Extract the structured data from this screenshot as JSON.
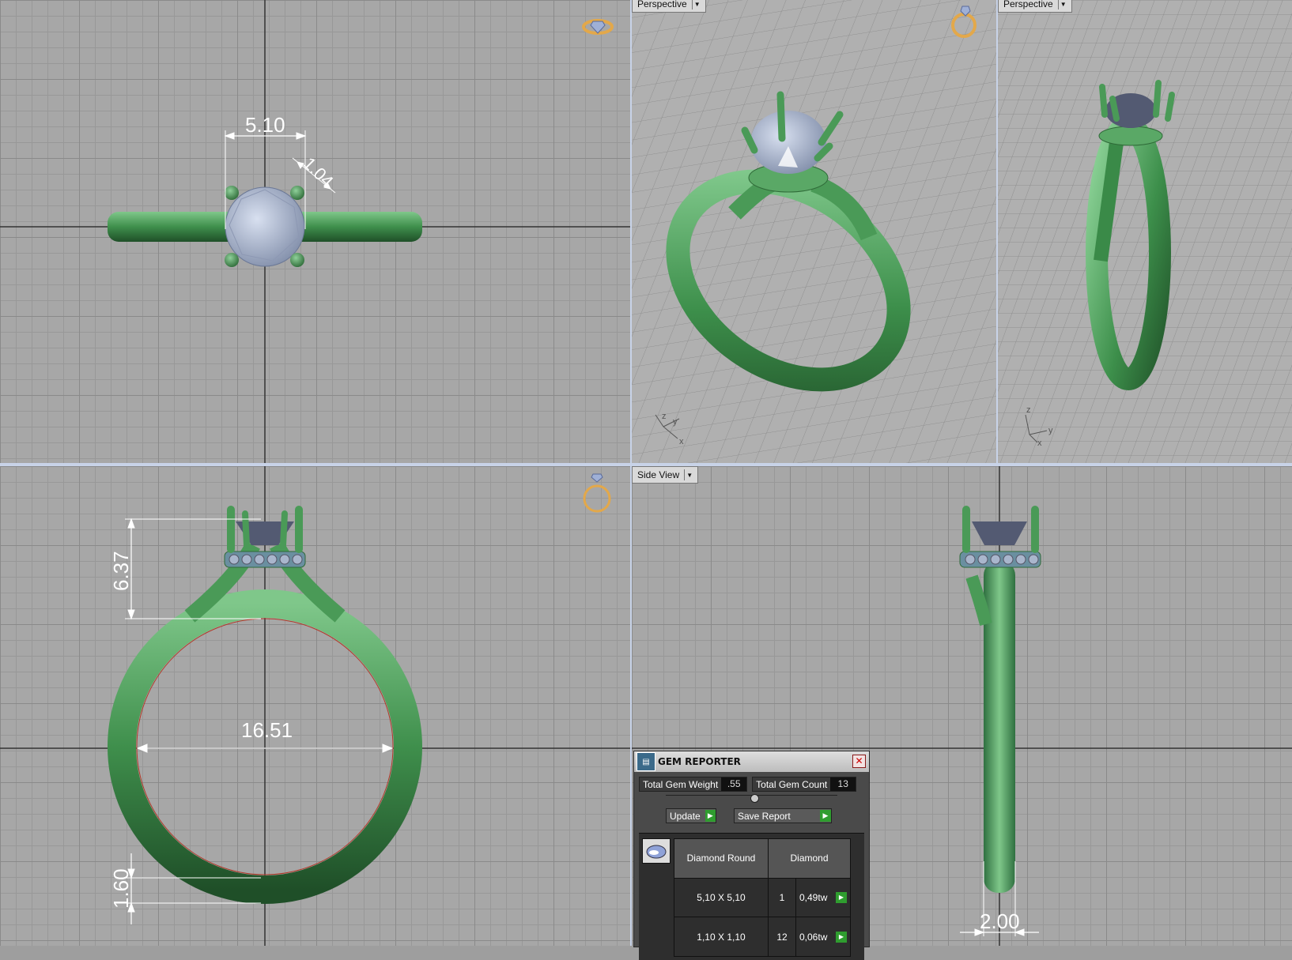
{
  "viewports": {
    "top_left": {
      "label": ""
    },
    "top_middle": {
      "label": "Perspective"
    },
    "top_right": {
      "label": "Perspective"
    },
    "bottom_left": {
      "label": ""
    },
    "bottom_right": {
      "label": "Side View"
    }
  },
  "dimensions": {
    "gem_width": "5.10",
    "prong_gap": "1.04",
    "setting_height": "6.37",
    "inner_diameter": "16.51",
    "band_thickness": "1.60",
    "band_width": "2.00"
  },
  "axis_labels": {
    "x": "x",
    "y": "y",
    "z": "z"
  },
  "gem_reporter": {
    "title": "GEM REPORTER",
    "total_weight_label": "Total Gem Weight",
    "total_weight_value": ".55",
    "total_count_label": "Total Gem Count",
    "total_count_value": "13",
    "update_label": "Update",
    "save_report_label": "Save Report",
    "table_headers": [
      "Diamond Round",
      "Diamond"
    ],
    "rows": [
      {
        "size": "5,10 X 5,10",
        "count": "1",
        "weight": "0,49tw"
      },
      {
        "size": "1,10 X 1,10",
        "count": "12",
        "weight": "0,06tw"
      }
    ]
  },
  "colors": {
    "ring_green": "#4fa15a",
    "gem_blue": "#aab4cc",
    "accent_gold": "#e3a84a",
    "go_green": "#2f9d2f"
  }
}
